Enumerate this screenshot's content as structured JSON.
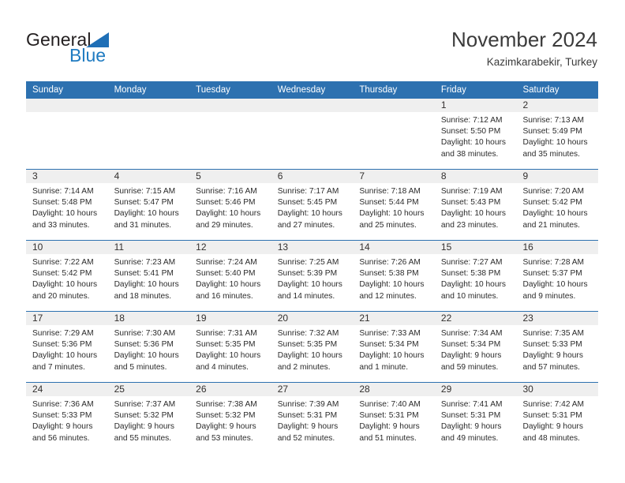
{
  "brand": {
    "name_top": "General",
    "name_bottom": "Blue",
    "triangle_icon": "triangle-icon",
    "color_dark": "#231f20",
    "color_blue": "#1f7bc1"
  },
  "header": {
    "title": "November 2024",
    "subtitle": "Kazimkarabekir, Turkey"
  },
  "theme": {
    "header_bar": "#2d71b0",
    "row_divider": "#2d71b0",
    "daynum_strip": "#efefef",
    "text": "#2b2b2b"
  },
  "weekdays": [
    "Sunday",
    "Monday",
    "Tuesday",
    "Wednesday",
    "Thursday",
    "Friday",
    "Saturday"
  ],
  "weeks": [
    [
      {
        "day": "",
        "sunrise": "",
        "sunset": "",
        "daylight": ""
      },
      {
        "day": "",
        "sunrise": "",
        "sunset": "",
        "daylight": ""
      },
      {
        "day": "",
        "sunrise": "",
        "sunset": "",
        "daylight": ""
      },
      {
        "day": "",
        "sunrise": "",
        "sunset": "",
        "daylight": ""
      },
      {
        "day": "",
        "sunrise": "",
        "sunset": "",
        "daylight": ""
      },
      {
        "day": "1",
        "sunrise": "Sunrise: 7:12 AM",
        "sunset": "Sunset: 5:50 PM",
        "daylight": "Daylight: 10 hours and 38 minutes."
      },
      {
        "day": "2",
        "sunrise": "Sunrise: 7:13 AM",
        "sunset": "Sunset: 5:49 PM",
        "daylight": "Daylight: 10 hours and 35 minutes."
      }
    ],
    [
      {
        "day": "3",
        "sunrise": "Sunrise: 7:14 AM",
        "sunset": "Sunset: 5:48 PM",
        "daylight": "Daylight: 10 hours and 33 minutes."
      },
      {
        "day": "4",
        "sunrise": "Sunrise: 7:15 AM",
        "sunset": "Sunset: 5:47 PM",
        "daylight": "Daylight: 10 hours and 31 minutes."
      },
      {
        "day": "5",
        "sunrise": "Sunrise: 7:16 AM",
        "sunset": "Sunset: 5:46 PM",
        "daylight": "Daylight: 10 hours and 29 minutes."
      },
      {
        "day": "6",
        "sunrise": "Sunrise: 7:17 AM",
        "sunset": "Sunset: 5:45 PM",
        "daylight": "Daylight: 10 hours and 27 minutes."
      },
      {
        "day": "7",
        "sunrise": "Sunrise: 7:18 AM",
        "sunset": "Sunset: 5:44 PM",
        "daylight": "Daylight: 10 hours and 25 minutes."
      },
      {
        "day": "8",
        "sunrise": "Sunrise: 7:19 AM",
        "sunset": "Sunset: 5:43 PM",
        "daylight": "Daylight: 10 hours and 23 minutes."
      },
      {
        "day": "9",
        "sunrise": "Sunrise: 7:20 AM",
        "sunset": "Sunset: 5:42 PM",
        "daylight": "Daylight: 10 hours and 21 minutes."
      }
    ],
    [
      {
        "day": "10",
        "sunrise": "Sunrise: 7:22 AM",
        "sunset": "Sunset: 5:42 PM",
        "daylight": "Daylight: 10 hours and 20 minutes."
      },
      {
        "day": "11",
        "sunrise": "Sunrise: 7:23 AM",
        "sunset": "Sunset: 5:41 PM",
        "daylight": "Daylight: 10 hours and 18 minutes."
      },
      {
        "day": "12",
        "sunrise": "Sunrise: 7:24 AM",
        "sunset": "Sunset: 5:40 PM",
        "daylight": "Daylight: 10 hours and 16 minutes."
      },
      {
        "day": "13",
        "sunrise": "Sunrise: 7:25 AM",
        "sunset": "Sunset: 5:39 PM",
        "daylight": "Daylight: 10 hours and 14 minutes."
      },
      {
        "day": "14",
        "sunrise": "Sunrise: 7:26 AM",
        "sunset": "Sunset: 5:38 PM",
        "daylight": "Daylight: 10 hours and 12 minutes."
      },
      {
        "day": "15",
        "sunrise": "Sunrise: 7:27 AM",
        "sunset": "Sunset: 5:38 PM",
        "daylight": "Daylight: 10 hours and 10 minutes."
      },
      {
        "day": "16",
        "sunrise": "Sunrise: 7:28 AM",
        "sunset": "Sunset: 5:37 PM",
        "daylight": "Daylight: 10 hours and 9 minutes."
      }
    ],
    [
      {
        "day": "17",
        "sunrise": "Sunrise: 7:29 AM",
        "sunset": "Sunset: 5:36 PM",
        "daylight": "Daylight: 10 hours and 7 minutes."
      },
      {
        "day": "18",
        "sunrise": "Sunrise: 7:30 AM",
        "sunset": "Sunset: 5:36 PM",
        "daylight": "Daylight: 10 hours and 5 minutes."
      },
      {
        "day": "19",
        "sunrise": "Sunrise: 7:31 AM",
        "sunset": "Sunset: 5:35 PM",
        "daylight": "Daylight: 10 hours and 4 minutes."
      },
      {
        "day": "20",
        "sunrise": "Sunrise: 7:32 AM",
        "sunset": "Sunset: 5:35 PM",
        "daylight": "Daylight: 10 hours and 2 minutes."
      },
      {
        "day": "21",
        "sunrise": "Sunrise: 7:33 AM",
        "sunset": "Sunset: 5:34 PM",
        "daylight": "Daylight: 10 hours and 1 minute."
      },
      {
        "day": "22",
        "sunrise": "Sunrise: 7:34 AM",
        "sunset": "Sunset: 5:34 PM",
        "daylight": "Daylight: 9 hours and 59 minutes."
      },
      {
        "day": "23",
        "sunrise": "Sunrise: 7:35 AM",
        "sunset": "Sunset: 5:33 PM",
        "daylight": "Daylight: 9 hours and 57 minutes."
      }
    ],
    [
      {
        "day": "24",
        "sunrise": "Sunrise: 7:36 AM",
        "sunset": "Sunset: 5:33 PM",
        "daylight": "Daylight: 9 hours and 56 minutes."
      },
      {
        "day": "25",
        "sunrise": "Sunrise: 7:37 AM",
        "sunset": "Sunset: 5:32 PM",
        "daylight": "Daylight: 9 hours and 55 minutes."
      },
      {
        "day": "26",
        "sunrise": "Sunrise: 7:38 AM",
        "sunset": "Sunset: 5:32 PM",
        "daylight": "Daylight: 9 hours and 53 minutes."
      },
      {
        "day": "27",
        "sunrise": "Sunrise: 7:39 AM",
        "sunset": "Sunset: 5:31 PM",
        "daylight": "Daylight: 9 hours and 52 minutes."
      },
      {
        "day": "28",
        "sunrise": "Sunrise: 7:40 AM",
        "sunset": "Sunset: 5:31 PM",
        "daylight": "Daylight: 9 hours and 51 minutes."
      },
      {
        "day": "29",
        "sunrise": "Sunrise: 7:41 AM",
        "sunset": "Sunset: 5:31 PM",
        "daylight": "Daylight: 9 hours and 49 minutes."
      },
      {
        "day": "30",
        "sunrise": "Sunrise: 7:42 AM",
        "sunset": "Sunset: 5:31 PM",
        "daylight": "Daylight: 9 hours and 48 minutes."
      }
    ]
  ]
}
